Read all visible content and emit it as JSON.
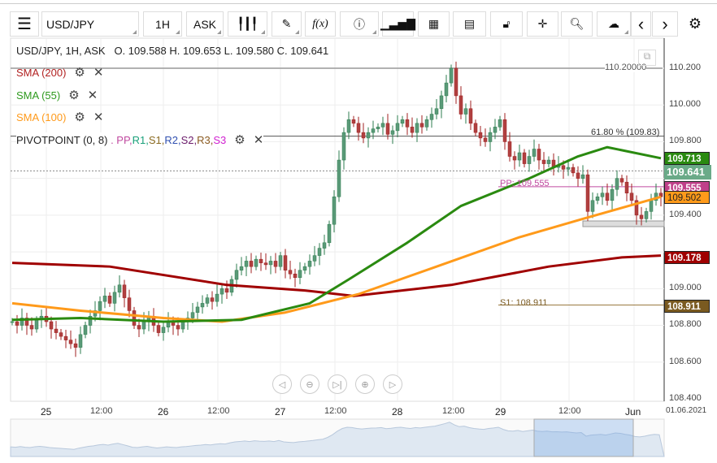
{
  "toolbar": {
    "symbol": "USD/JPY",
    "interval": "1H",
    "price_type": "ASK",
    "fx_label": "f(x)",
    "icons": [
      "menu-icon",
      "candlestick-icon",
      "pencil-icon",
      "function-icon",
      "info-icon",
      "bar-chart-icon",
      "calendar-icon",
      "document-icon",
      "lock-icon",
      "crosshair-icon",
      "zoom-icon",
      "cloud-upload-icon",
      "chevron-left-icon",
      "chevron-right-icon",
      "gear-icon"
    ],
    "prev": "‹",
    "next": "›"
  },
  "header": {
    "info": "USD/JPY, 1H, ASK",
    "ohlc": "O. 109.588 H. 109.653 L. 109.580 C. 109.641"
  },
  "indicators": [
    {
      "label": "SMA (200)",
      "color": "#b22222"
    },
    {
      "label": "SMA (55)",
      "color": "#2e9a1e"
    },
    {
      "label": "SMA (100)",
      "color": "#ff9a1a"
    }
  ],
  "pivot": {
    "label": "PIVOTPOINT (0, 8)",
    "parts": [
      ". PP,",
      "R1,",
      "S1,",
      "R2,",
      "S2,",
      "R3,",
      "S3"
    ],
    "colors": [
      "#c04aa0",
      "#1aa07a",
      "#8a6a20",
      "#3050b0",
      "#6a1a6a",
      "#8a5a20",
      "#d020d0"
    ]
  },
  "annotations": {
    "hline": "110.20000",
    "fib": "61.80 % (109.83)",
    "pp": "PP: 109.555",
    "s1": "S1: 108.911"
  },
  "y_axis": [
    "110.200",
    "110.000",
    "109.800",
    "109.400",
    "109.000",
    "108.800",
    "108.600",
    "108.400"
  ],
  "price_tags": [
    {
      "value": "109.713",
      "color": "#2a8a10"
    },
    {
      "value": "109.641",
      "color": "#6aaa88"
    },
    {
      "value": "109.555",
      "color": "#c0408a"
    },
    {
      "value": "109.502",
      "color": "#ff9a1a"
    },
    {
      "value": "109.178",
      "color": "#a00000"
    },
    {
      "value": "108.911",
      "color": "#7a5a20"
    }
  ],
  "x_axis": [
    {
      "label": "25",
      "day": true
    },
    {
      "label": "12:00"
    },
    {
      "label": "26",
      "day": true
    },
    {
      "label": "12:00"
    },
    {
      "label": "27",
      "day": true
    },
    {
      "label": "12:00"
    },
    {
      "label": "28",
      "day": true
    },
    {
      "label": "12:00"
    },
    {
      "label": "29",
      "day": true
    },
    {
      "label": "12:00"
    },
    {
      "label": "Jun",
      "day": true
    },
    {
      "label": "01.06.2021"
    }
  ],
  "nav_buttons": [
    "◁",
    "⊖",
    "▷|",
    "⊕",
    "▷"
  ],
  "chart_data": {
    "type": "candlestick",
    "ylim": [
      108.4,
      110.2
    ],
    "closes": [
      108.82,
      108.8,
      108.84,
      108.8,
      108.78,
      108.83,
      108.85,
      108.82,
      108.78,
      108.76,
      108.74,
      108.72,
      108.7,
      108.68,
      108.75,
      108.8,
      108.85,
      108.88,
      108.93,
      108.96,
      108.92,
      108.98,
      109.02,
      108.95,
      108.88,
      108.8,
      108.78,
      108.82,
      108.85,
      108.8,
      108.76,
      108.79,
      108.82,
      108.8,
      108.78,
      108.82,
      108.84,
      108.87,
      108.9,
      108.92,
      108.95,
      108.93,
      108.97,
      109.0,
      108.98,
      109.05,
      109.1,
      109.12,
      109.15,
      109.12,
      109.16,
      109.14,
      109.13,
      109.15,
      109.12,
      109.18,
      109.1,
      109.08,
      109.06,
      109.1,
      109.12,
      109.15,
      109.18,
      109.22,
      109.25,
      109.35,
      109.5,
      109.7,
      109.85,
      109.92,
      109.9,
      109.85,
      109.82,
      109.85,
      109.87,
      109.88,
      109.9,
      109.84,
      109.86,
      109.9,
      109.92,
      109.88,
      109.85,
      109.9,
      109.88,
      109.92,
      109.95,
      109.98,
      110.05,
      110.12,
      110.2,
      110.05,
      109.95,
      109.98,
      109.9,
      109.85,
      109.82,
      109.8,
      109.85,
      109.88,
      109.92,
      109.8,
      109.72,
      109.7,
      109.74,
      109.68,
      109.72,
      109.76,
      109.7,
      109.68,
      109.7,
      109.66,
      109.67,
      109.65,
      109.66,
      109.63,
      109.6,
      109.62,
      109.42,
      109.48,
      109.5,
      109.52,
      109.48,
      109.54,
      109.6,
      109.58,
      109.52,
      109.48,
      109.4,
      109.38,
      109.42,
      109.48,
      109.52,
      109.5
    ],
    "sma200": [
      [
        0,
        109.14
      ],
      [
        20,
        109.12
      ],
      [
        44,
        109.02
      ],
      [
        60,
        108.99
      ],
      [
        70,
        108.96
      ],
      [
        90,
        109.02
      ],
      [
        110,
        109.12
      ],
      [
        125,
        109.17
      ],
      [
        133,
        109.18
      ]
    ],
    "sma55": [
      [
        0,
        108.83
      ],
      [
        14,
        108.84
      ],
      [
        31,
        108.82
      ],
      [
        47,
        108.83
      ],
      [
        61,
        108.92
      ],
      [
        69,
        109.05
      ],
      [
        81,
        109.25
      ],
      [
        92,
        109.45
      ],
      [
        106,
        109.6
      ],
      [
        116,
        109.72
      ],
      [
        122,
        109.77
      ],
      [
        133,
        109.71
      ]
    ],
    "sma100": [
      [
        0,
        108.92
      ],
      [
        14,
        108.88
      ],
      [
        31,
        108.84
      ],
      [
        43,
        108.82
      ],
      [
        56,
        108.87
      ],
      [
        71,
        108.97
      ],
      [
        87,
        109.12
      ],
      [
        104,
        109.28
      ],
      [
        117,
        109.38
      ],
      [
        133,
        109.5
      ]
    ],
    "levels": {
      "hline": 110.2,
      "fib": 109.83,
      "pp": 109.555,
      "s1": 108.911,
      "last": 109.641
    }
  }
}
